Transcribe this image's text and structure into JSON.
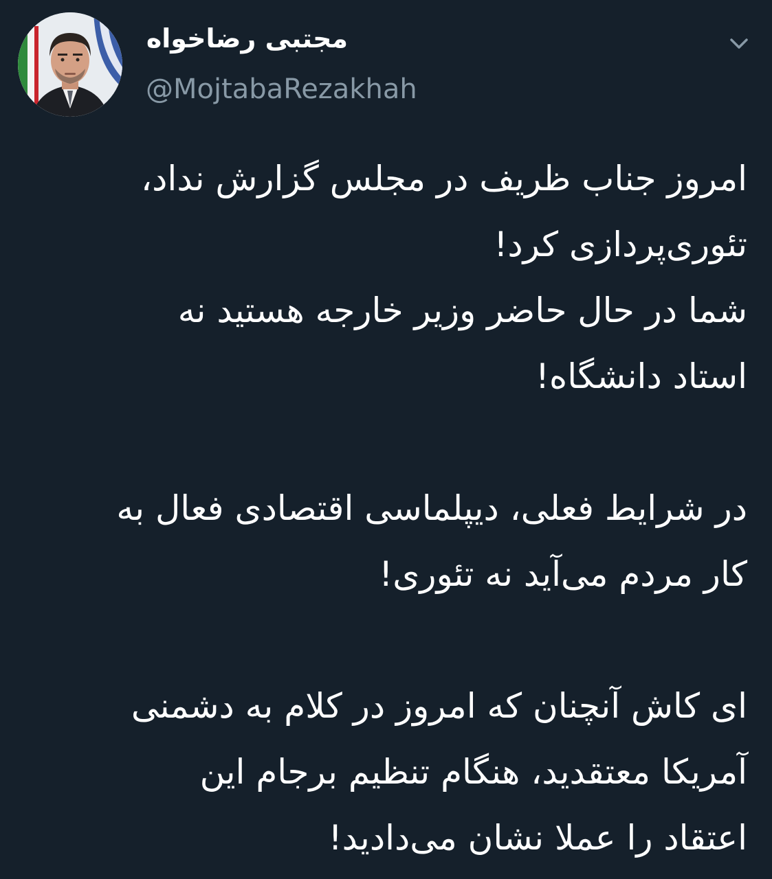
{
  "author": {
    "display_name": "مجتبی رضاخواه",
    "handle": "@MojtabaRezakhah",
    "avatar_icon": "profile-photo"
  },
  "menu": {
    "caret_icon": "chevron-down-icon"
  },
  "tweet": {
    "paragraphs": [
      {
        "lines": [
          "امروز جناب ظریف در مجلس گزارش نداد،",
          "تئوری‌پردازی کرد!",
          "شما در حال حاضر وزیر خارجه هستید نه",
          "استاد دانشگاه!"
        ]
      },
      {
        "lines": [
          "در شرایط فعلی، دیپلماسی اقتصادی فعال به",
          "کار مردم می‌آید نه تئوری!"
        ]
      },
      {
        "lines": [
          "ای کاش آنچنان که امروز در کلام به دشمنی",
          "آمریکا معتقدید، هنگام تنظیم برجام این",
          "اعتقاد را عملا نشان می‌دادید!"
        ]
      }
    ]
  },
  "colors": {
    "background": "#15202b",
    "primary_text": "#ffffff",
    "secondary_text": "#8899a6"
  }
}
